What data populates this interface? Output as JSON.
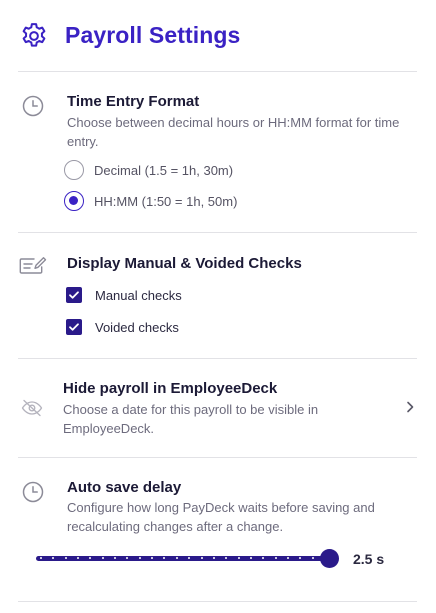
{
  "header": {
    "title": "Payroll Settings",
    "icon": "gear-icon"
  },
  "time_entry": {
    "title": "Time Entry Format",
    "description": "Choose between decimal hours or HH:MM format for time entry.",
    "icon": "clock-icon",
    "options": [
      {
        "label": "Decimal (1.5 = 1h, 30m)",
        "selected": false
      },
      {
        "label": "HH:MM (1:50 = 1h, 50m)",
        "selected": true
      }
    ]
  },
  "checks": {
    "title": "Display Manual & Voided Checks",
    "icon": "check-edit-icon",
    "items": [
      {
        "label": "Manual checks",
        "checked": true
      },
      {
        "label": "Voided checks",
        "checked": true
      }
    ]
  },
  "hide_payroll": {
    "title": "Hide payroll in EmployeeDeck",
    "description": "Choose a date for this payroll to be visible in EmployeeDeck.",
    "icon": "eye-off-icon"
  },
  "auto_save": {
    "title": "Auto save delay",
    "description": "Configure how long PayDeck waits before saving and recalculating changes after a change.",
    "icon": "clock-icon",
    "value_label": "2.5 s",
    "slider_fraction": 1.0
  },
  "colors": {
    "accent": "#3a22c4",
    "dark_accent": "#2a1a8a",
    "divider": "#e2e2e6"
  }
}
